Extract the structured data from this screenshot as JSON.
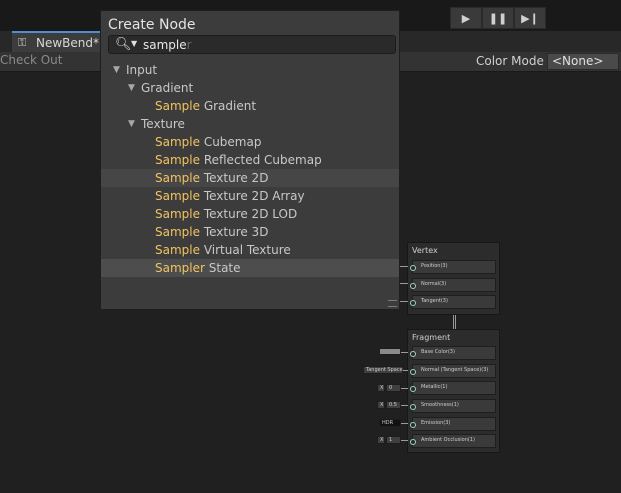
{
  "playmode": {
    "play_icon": "play-icon",
    "pause_icon": "pause-icon",
    "step_icon": "step-icon"
  },
  "tab": {
    "label": "NewBend*",
    "icon": "shadergraph-icon"
  },
  "toolbar": {
    "check_out": "Check Out",
    "color_mode_label": "Color Mode",
    "color_mode_value": "<None>"
  },
  "popup": {
    "title": "Create Node",
    "search_value": "sample",
    "search_hint_suffix": "r",
    "items": [
      {
        "type": "category",
        "label": "Input",
        "level": 0
      },
      {
        "type": "category",
        "label": "Gradient",
        "level": 1
      },
      {
        "type": "leaf",
        "match": "Sample",
        "rest": " Gradient"
      },
      {
        "type": "category",
        "label": "Texture",
        "level": 1
      },
      {
        "type": "leaf",
        "match": "Sample",
        "rest": " Cubemap"
      },
      {
        "type": "leaf",
        "match": "Sample",
        "rest": " Reflected Cubemap"
      },
      {
        "type": "leaf",
        "match": "Sample",
        "rest": " Texture 2D",
        "state": "hover"
      },
      {
        "type": "leaf",
        "match": "Sample",
        "rest": " Texture 2D Array"
      },
      {
        "type": "leaf",
        "match": "Sample",
        "rest": " Texture 2D LOD"
      },
      {
        "type": "leaf",
        "match": "Sample",
        "rest": " Texture 3D"
      },
      {
        "type": "leaf",
        "match": "Sample",
        "rest": " Virtual Texture"
      },
      {
        "type": "leaf",
        "match": "Sampler",
        "rest": " State",
        "state": "selected"
      }
    ]
  },
  "vertex": {
    "title": "Vertex",
    "blocks": [
      "Position(3)",
      "Normal(3)",
      "Tangent(3)"
    ]
  },
  "fragment": {
    "title": "Fragment",
    "blocks": [
      "Base Color(3)",
      "Normal (Tangent Space)(3)",
      "Metallic(1)",
      "Smoothness(1)",
      "Emission(3)",
      "Ambient Occlusion(1)"
    ],
    "inputs": [
      {
        "kind": "swatch"
      },
      {
        "kind": "text",
        "text": "Tangent Space"
      },
      {
        "kind": "text",
        "label": "X",
        "text": "0"
      },
      {
        "kind": "text",
        "label": "X",
        "text": "0.5"
      },
      {
        "kind": "text",
        "text": "HDR"
      },
      {
        "kind": "text",
        "label": "X",
        "text": "1"
      }
    ]
  },
  "colors": {
    "match": "#f3c361",
    "accent": "#4f8dd6"
  }
}
